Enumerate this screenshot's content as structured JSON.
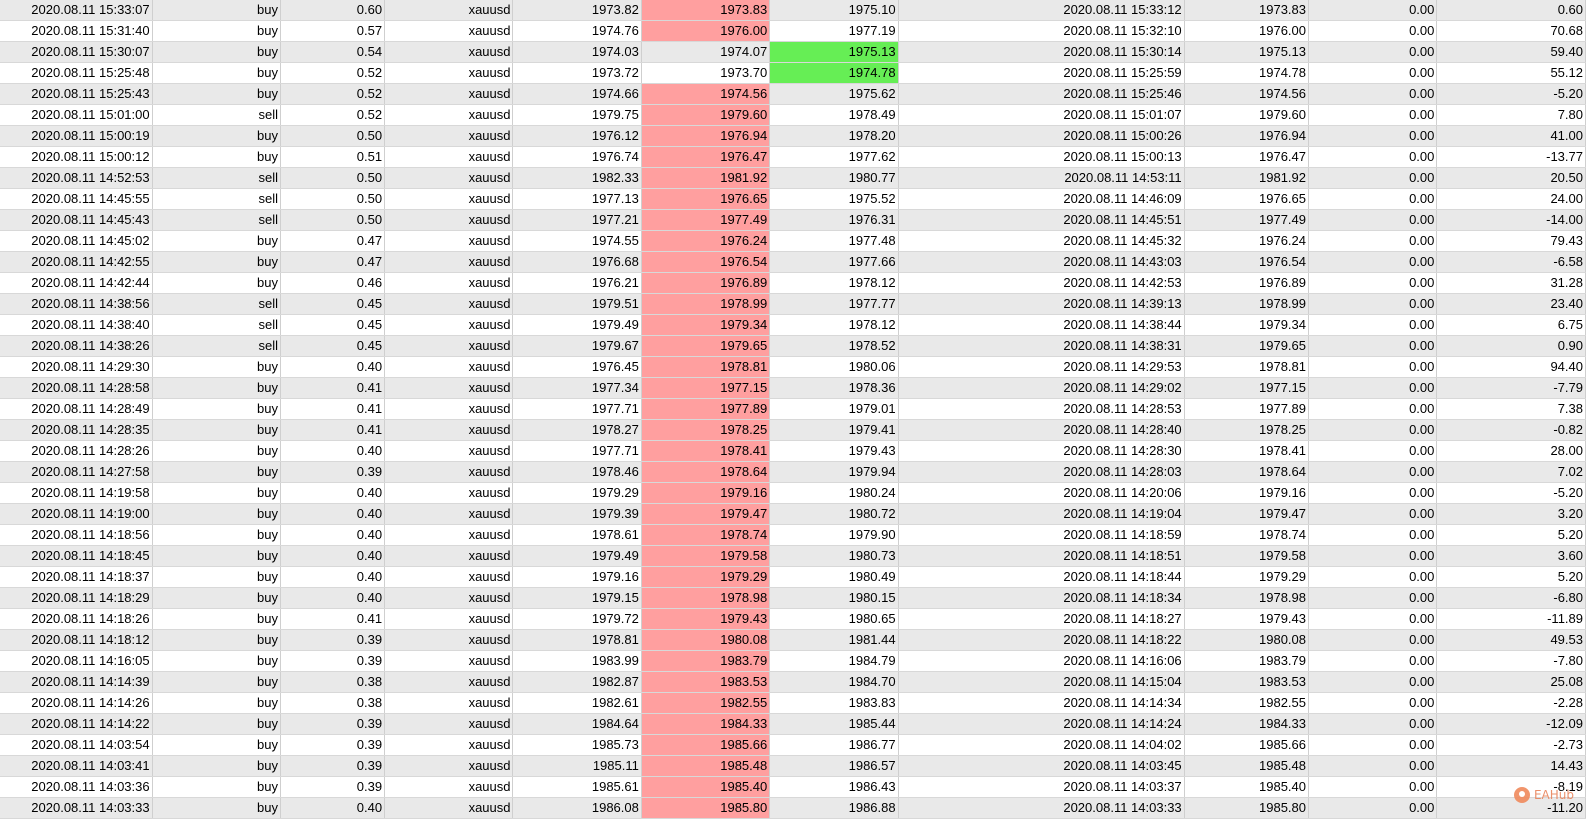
{
  "colors": {
    "row_shade": "#e9e9e9",
    "row_plain": "#ffffff",
    "highlight_red": "#ff9f9f",
    "highlight_green": "#66ee55"
  },
  "watermark": {
    "icon": "eahub-logo-icon",
    "text": "EAHub"
  },
  "rows": [
    {
      "open_time": "2020.08.11 15:33:07",
      "type": "buy",
      "volume": "0.60",
      "symbol": "xauusd",
      "open_price": "1973.82",
      "sl": "1973.83",
      "tp": "1975.10",
      "close_time": "2020.08.11 15:33:12",
      "close_price": "1973.83",
      "swap": "0.00",
      "profit": "0.60",
      "sl_hit": true,
      "tp_hit": false
    },
    {
      "open_time": "2020.08.11 15:31:40",
      "type": "buy",
      "volume": "0.57",
      "symbol": "xauusd",
      "open_price": "1974.76",
      "sl": "1976.00",
      "tp": "1977.19",
      "close_time": "2020.08.11 15:32:10",
      "close_price": "1976.00",
      "swap": "0.00",
      "profit": "70.68",
      "sl_hit": true,
      "tp_hit": false
    },
    {
      "open_time": "2020.08.11 15:30:07",
      "type": "buy",
      "volume": "0.54",
      "symbol": "xauusd",
      "open_price": "1974.03",
      "sl": "1974.07",
      "tp": "1975.13",
      "close_time": "2020.08.11 15:30:14",
      "close_price": "1975.13",
      "swap": "0.00",
      "profit": "59.40",
      "sl_hit": false,
      "tp_hit": true
    },
    {
      "open_time": "2020.08.11 15:25:48",
      "type": "buy",
      "volume": "0.52",
      "symbol": "xauusd",
      "open_price": "1973.72",
      "sl": "1973.70",
      "tp": "1974.78",
      "close_time": "2020.08.11 15:25:59",
      "close_price": "1974.78",
      "swap": "0.00",
      "profit": "55.12",
      "sl_hit": false,
      "tp_hit": true
    },
    {
      "open_time": "2020.08.11 15:25:43",
      "type": "buy",
      "volume": "0.52",
      "symbol": "xauusd",
      "open_price": "1974.66",
      "sl": "1974.56",
      "tp": "1975.62",
      "close_time": "2020.08.11 15:25:46",
      "close_price": "1974.56",
      "swap": "0.00",
      "profit": "-5.20",
      "sl_hit": true,
      "tp_hit": false
    },
    {
      "open_time": "2020.08.11 15:01:00",
      "type": "sell",
      "volume": "0.52",
      "symbol": "xauusd",
      "open_price": "1979.75",
      "sl": "1979.60",
      "tp": "1978.49",
      "close_time": "2020.08.11 15:01:07",
      "close_price": "1979.60",
      "swap": "0.00",
      "profit": "7.80",
      "sl_hit": true,
      "tp_hit": false
    },
    {
      "open_time": "2020.08.11 15:00:19",
      "type": "buy",
      "volume": "0.50",
      "symbol": "xauusd",
      "open_price": "1976.12",
      "sl": "1976.94",
      "tp": "1978.20",
      "close_time": "2020.08.11 15:00:26",
      "close_price": "1976.94",
      "swap": "0.00",
      "profit": "41.00",
      "sl_hit": true,
      "tp_hit": false
    },
    {
      "open_time": "2020.08.11 15:00:12",
      "type": "buy",
      "volume": "0.51",
      "symbol": "xauusd",
      "open_price": "1976.74",
      "sl": "1976.47",
      "tp": "1977.62",
      "close_time": "2020.08.11 15:00:13",
      "close_price": "1976.47",
      "swap": "0.00",
      "profit": "-13.77",
      "sl_hit": true,
      "tp_hit": false
    },
    {
      "open_time": "2020.08.11 14:52:53",
      "type": "sell",
      "volume": "0.50",
      "symbol": "xauusd",
      "open_price": "1982.33",
      "sl": "1981.92",
      "tp": "1980.77",
      "close_time": "2020.08.11 14:53:11",
      "close_price": "1981.92",
      "swap": "0.00",
      "profit": "20.50",
      "sl_hit": true,
      "tp_hit": false
    },
    {
      "open_time": "2020.08.11 14:45:55",
      "type": "sell",
      "volume": "0.50",
      "symbol": "xauusd",
      "open_price": "1977.13",
      "sl": "1976.65",
      "tp": "1975.52",
      "close_time": "2020.08.11 14:46:09",
      "close_price": "1976.65",
      "swap": "0.00",
      "profit": "24.00",
      "sl_hit": true,
      "tp_hit": false
    },
    {
      "open_time": "2020.08.11 14:45:43",
      "type": "sell",
      "volume": "0.50",
      "symbol": "xauusd",
      "open_price": "1977.21",
      "sl": "1977.49",
      "tp": "1976.31",
      "close_time": "2020.08.11 14:45:51",
      "close_price": "1977.49",
      "swap": "0.00",
      "profit": "-14.00",
      "sl_hit": true,
      "tp_hit": false
    },
    {
      "open_time": "2020.08.11 14:45:02",
      "type": "buy",
      "volume": "0.47",
      "symbol": "xauusd",
      "open_price": "1974.55",
      "sl": "1976.24",
      "tp": "1977.48",
      "close_time": "2020.08.11 14:45:32",
      "close_price": "1976.24",
      "swap": "0.00",
      "profit": "79.43",
      "sl_hit": true,
      "tp_hit": false
    },
    {
      "open_time": "2020.08.11 14:42:55",
      "type": "buy",
      "volume": "0.47",
      "symbol": "xauusd",
      "open_price": "1976.68",
      "sl": "1976.54",
      "tp": "1977.66",
      "close_time": "2020.08.11 14:43:03",
      "close_price": "1976.54",
      "swap": "0.00",
      "profit": "-6.58",
      "sl_hit": true,
      "tp_hit": false
    },
    {
      "open_time": "2020.08.11 14:42:44",
      "type": "buy",
      "volume": "0.46",
      "symbol": "xauusd",
      "open_price": "1976.21",
      "sl": "1976.89",
      "tp": "1978.12",
      "close_time": "2020.08.11 14:42:53",
      "close_price": "1976.89",
      "swap": "0.00",
      "profit": "31.28",
      "sl_hit": true,
      "tp_hit": false
    },
    {
      "open_time": "2020.08.11 14:38:56",
      "type": "sell",
      "volume": "0.45",
      "symbol": "xauusd",
      "open_price": "1979.51",
      "sl": "1978.99",
      "tp": "1977.77",
      "close_time": "2020.08.11 14:39:13",
      "close_price": "1978.99",
      "swap": "0.00",
      "profit": "23.40",
      "sl_hit": true,
      "tp_hit": false
    },
    {
      "open_time": "2020.08.11 14:38:40",
      "type": "sell",
      "volume": "0.45",
      "symbol": "xauusd",
      "open_price": "1979.49",
      "sl": "1979.34",
      "tp": "1978.12",
      "close_time": "2020.08.11 14:38:44",
      "close_price": "1979.34",
      "swap": "0.00",
      "profit": "6.75",
      "sl_hit": true,
      "tp_hit": false
    },
    {
      "open_time": "2020.08.11 14:38:26",
      "type": "sell",
      "volume": "0.45",
      "symbol": "xauusd",
      "open_price": "1979.67",
      "sl": "1979.65",
      "tp": "1978.52",
      "close_time": "2020.08.11 14:38:31",
      "close_price": "1979.65",
      "swap": "0.00",
      "profit": "0.90",
      "sl_hit": true,
      "tp_hit": false
    },
    {
      "open_time": "2020.08.11 14:29:30",
      "type": "buy",
      "volume": "0.40",
      "symbol": "xauusd",
      "open_price": "1976.45",
      "sl": "1978.81",
      "tp": "1980.06",
      "close_time": "2020.08.11 14:29:53",
      "close_price": "1978.81",
      "swap": "0.00",
      "profit": "94.40",
      "sl_hit": true,
      "tp_hit": false
    },
    {
      "open_time": "2020.08.11 14:28:58",
      "type": "buy",
      "volume": "0.41",
      "symbol": "xauusd",
      "open_price": "1977.34",
      "sl": "1977.15",
      "tp": "1978.36",
      "close_time": "2020.08.11 14:29:02",
      "close_price": "1977.15",
      "swap": "0.00",
      "profit": "-7.79",
      "sl_hit": true,
      "tp_hit": false
    },
    {
      "open_time": "2020.08.11 14:28:49",
      "type": "buy",
      "volume": "0.41",
      "symbol": "xauusd",
      "open_price": "1977.71",
      "sl": "1977.89",
      "tp": "1979.01",
      "close_time": "2020.08.11 14:28:53",
      "close_price": "1977.89",
      "swap": "0.00",
      "profit": "7.38",
      "sl_hit": true,
      "tp_hit": false
    },
    {
      "open_time": "2020.08.11 14:28:35",
      "type": "buy",
      "volume": "0.41",
      "symbol": "xauusd",
      "open_price": "1978.27",
      "sl": "1978.25",
      "tp": "1979.41",
      "close_time": "2020.08.11 14:28:40",
      "close_price": "1978.25",
      "swap": "0.00",
      "profit": "-0.82",
      "sl_hit": true,
      "tp_hit": false
    },
    {
      "open_time": "2020.08.11 14:28:26",
      "type": "buy",
      "volume": "0.40",
      "symbol": "xauusd",
      "open_price": "1977.71",
      "sl": "1978.41",
      "tp": "1979.43",
      "close_time": "2020.08.11 14:28:30",
      "close_price": "1978.41",
      "swap": "0.00",
      "profit": "28.00",
      "sl_hit": true,
      "tp_hit": false
    },
    {
      "open_time": "2020.08.11 14:27:58",
      "type": "buy",
      "volume": "0.39",
      "symbol": "xauusd",
      "open_price": "1978.46",
      "sl": "1978.64",
      "tp": "1979.94",
      "close_time": "2020.08.11 14:28:03",
      "close_price": "1978.64",
      "swap": "0.00",
      "profit": "7.02",
      "sl_hit": true,
      "tp_hit": false
    },
    {
      "open_time": "2020.08.11 14:19:58",
      "type": "buy",
      "volume": "0.40",
      "symbol": "xauusd",
      "open_price": "1979.29",
      "sl": "1979.16",
      "tp": "1980.24",
      "close_time": "2020.08.11 14:20:06",
      "close_price": "1979.16",
      "swap": "0.00",
      "profit": "-5.20",
      "sl_hit": true,
      "tp_hit": false
    },
    {
      "open_time": "2020.08.11 14:19:00",
      "type": "buy",
      "volume": "0.40",
      "symbol": "xauusd",
      "open_price": "1979.39",
      "sl": "1979.47",
      "tp": "1980.72",
      "close_time": "2020.08.11 14:19:04",
      "close_price": "1979.47",
      "swap": "0.00",
      "profit": "3.20",
      "sl_hit": true,
      "tp_hit": false
    },
    {
      "open_time": "2020.08.11 14:18:56",
      "type": "buy",
      "volume": "0.40",
      "symbol": "xauusd",
      "open_price": "1978.61",
      "sl": "1978.74",
      "tp": "1979.90",
      "close_time": "2020.08.11 14:18:59",
      "close_price": "1978.74",
      "swap": "0.00",
      "profit": "5.20",
      "sl_hit": true,
      "tp_hit": false
    },
    {
      "open_time": "2020.08.11 14:18:45",
      "type": "buy",
      "volume": "0.40",
      "symbol": "xauusd",
      "open_price": "1979.49",
      "sl": "1979.58",
      "tp": "1980.73",
      "close_time": "2020.08.11 14:18:51",
      "close_price": "1979.58",
      "swap": "0.00",
      "profit": "3.60",
      "sl_hit": true,
      "tp_hit": false
    },
    {
      "open_time": "2020.08.11 14:18:37",
      "type": "buy",
      "volume": "0.40",
      "symbol": "xauusd",
      "open_price": "1979.16",
      "sl": "1979.29",
      "tp": "1980.49",
      "close_time": "2020.08.11 14:18:44",
      "close_price": "1979.29",
      "swap": "0.00",
      "profit": "5.20",
      "sl_hit": true,
      "tp_hit": false
    },
    {
      "open_time": "2020.08.11 14:18:29",
      "type": "buy",
      "volume": "0.40",
      "symbol": "xauusd",
      "open_price": "1979.15",
      "sl": "1978.98",
      "tp": "1980.15",
      "close_time": "2020.08.11 14:18:34",
      "close_price": "1978.98",
      "swap": "0.00",
      "profit": "-6.80",
      "sl_hit": true,
      "tp_hit": false
    },
    {
      "open_time": "2020.08.11 14:18:26",
      "type": "buy",
      "volume": "0.41",
      "symbol": "xauusd",
      "open_price": "1979.72",
      "sl": "1979.43",
      "tp": "1980.65",
      "close_time": "2020.08.11 14:18:27",
      "close_price": "1979.43",
      "swap": "0.00",
      "profit": "-11.89",
      "sl_hit": true,
      "tp_hit": false
    },
    {
      "open_time": "2020.08.11 14:18:12",
      "type": "buy",
      "volume": "0.39",
      "symbol": "xauusd",
      "open_price": "1978.81",
      "sl": "1980.08",
      "tp": "1981.44",
      "close_time": "2020.08.11 14:18:22",
      "close_price": "1980.08",
      "swap": "0.00",
      "profit": "49.53",
      "sl_hit": true,
      "tp_hit": false
    },
    {
      "open_time": "2020.08.11 14:16:05",
      "type": "buy",
      "volume": "0.39",
      "symbol": "xauusd",
      "open_price": "1983.99",
      "sl": "1983.79",
      "tp": "1984.79",
      "close_time": "2020.08.11 14:16:06",
      "close_price": "1983.79",
      "swap": "0.00",
      "profit": "-7.80",
      "sl_hit": true,
      "tp_hit": false
    },
    {
      "open_time": "2020.08.11 14:14:39",
      "type": "buy",
      "volume": "0.38",
      "symbol": "xauusd",
      "open_price": "1982.87",
      "sl": "1983.53",
      "tp": "1984.70",
      "close_time": "2020.08.11 14:15:04",
      "close_price": "1983.53",
      "swap": "0.00",
      "profit": "25.08",
      "sl_hit": true,
      "tp_hit": false
    },
    {
      "open_time": "2020.08.11 14:14:26",
      "type": "buy",
      "volume": "0.38",
      "symbol": "xauusd",
      "open_price": "1982.61",
      "sl": "1982.55",
      "tp": "1983.83",
      "close_time": "2020.08.11 14:14:34",
      "close_price": "1982.55",
      "swap": "0.00",
      "profit": "-2.28",
      "sl_hit": true,
      "tp_hit": false
    },
    {
      "open_time": "2020.08.11 14:14:22",
      "type": "buy",
      "volume": "0.39",
      "symbol": "xauusd",
      "open_price": "1984.64",
      "sl": "1984.33",
      "tp": "1985.44",
      "close_time": "2020.08.11 14:14:24",
      "close_price": "1984.33",
      "swap": "0.00",
      "profit": "-12.09",
      "sl_hit": true,
      "tp_hit": false
    },
    {
      "open_time": "2020.08.11 14:03:54",
      "type": "buy",
      "volume": "0.39",
      "symbol": "xauusd",
      "open_price": "1985.73",
      "sl": "1985.66",
      "tp": "1986.77",
      "close_time": "2020.08.11 14:04:02",
      "close_price": "1985.66",
      "swap": "0.00",
      "profit": "-2.73",
      "sl_hit": true,
      "tp_hit": false
    },
    {
      "open_time": "2020.08.11 14:03:41",
      "type": "buy",
      "volume": "0.39",
      "symbol": "xauusd",
      "open_price": "1985.11",
      "sl": "1985.48",
      "tp": "1986.57",
      "close_time": "2020.08.11 14:03:45",
      "close_price": "1985.48",
      "swap": "0.00",
      "profit": "14.43",
      "sl_hit": true,
      "tp_hit": false
    },
    {
      "open_time": "2020.08.11 14:03:36",
      "type": "buy",
      "volume": "0.39",
      "symbol": "xauusd",
      "open_price": "1985.61",
      "sl": "1985.40",
      "tp": "1986.43",
      "close_time": "2020.08.11 14:03:37",
      "close_price": "1985.40",
      "swap": "0.00",
      "profit": "-8.19",
      "sl_hit": true,
      "tp_hit": false
    },
    {
      "open_time": "2020.08.11 14:03:33",
      "type": "buy",
      "volume": "0.40",
      "symbol": "xauusd",
      "open_price": "1986.08",
      "sl": "1985.80",
      "tp": "1986.88",
      "close_time": "2020.08.11 14:03:33",
      "close_price": "1985.80",
      "swap": "0.00",
      "profit": "-11.20",
      "sl_hit": true,
      "tp_hit": false
    }
  ]
}
